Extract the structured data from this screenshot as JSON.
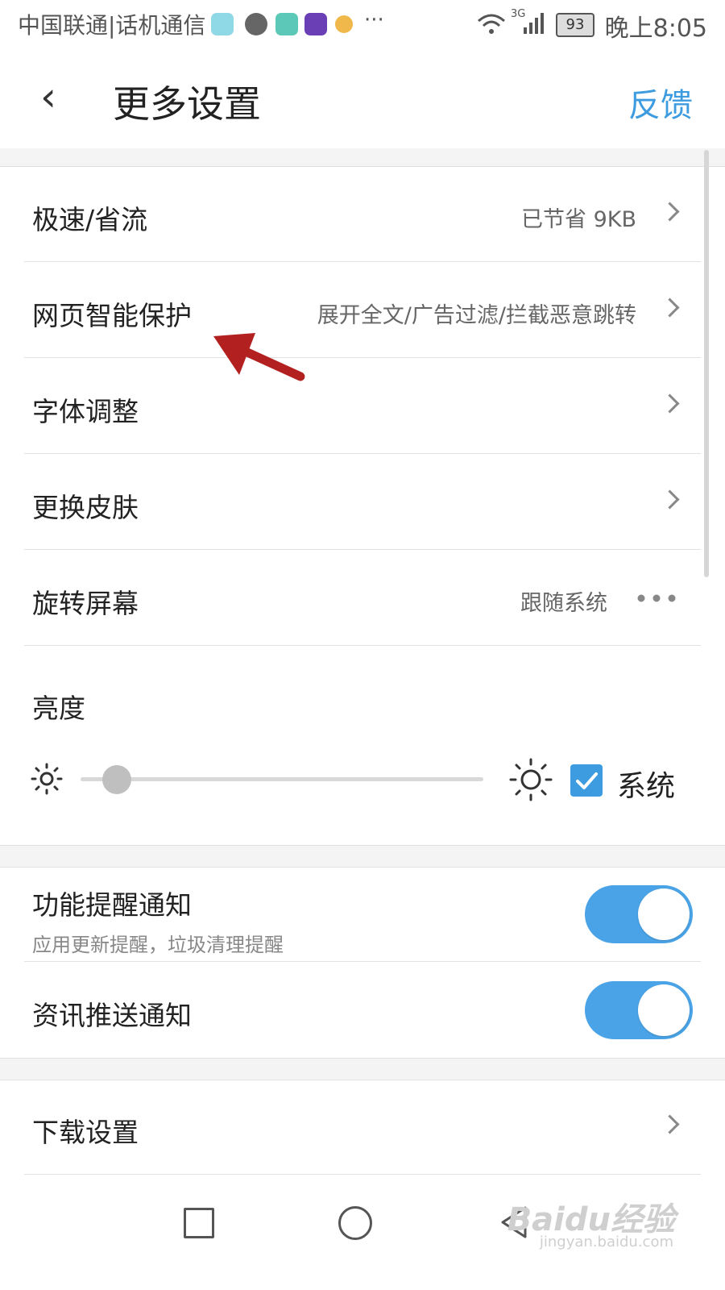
{
  "status_bar": {
    "carrier": "中国联通|话机通信",
    "battery": "93",
    "network": "3G",
    "time": "晚上8:05",
    "more": "···"
  },
  "header": {
    "back_icon": "chevron-left-icon",
    "title": "更多设置",
    "feedback": "反馈"
  },
  "rows": [
    {
      "label": "极速/省流",
      "value": "已节省 9KB",
      "trailing": "chevron-right-icon"
    },
    {
      "label": "网页智能保护",
      "value": "展开全文/广告过滤/拦截恶意跳转",
      "trailing": "chevron-right-icon"
    },
    {
      "label": "字体调整",
      "value": "",
      "trailing": "chevron-right-icon"
    },
    {
      "label": "更换皮肤",
      "value": "",
      "trailing": "chevron-right-icon"
    },
    {
      "label": "旋转屏幕",
      "value": "跟随系统",
      "trailing": "more-dots-icon"
    }
  ],
  "brightness": {
    "label": "亮度",
    "level": 0.09,
    "system_checked": true,
    "system_label": "系统"
  },
  "notifications": [
    {
      "label": "功能提醒通知",
      "sub": "应用更新提醒，垃圾清理提醒",
      "on": true
    },
    {
      "label": "资讯推送通知",
      "sub": "",
      "on": true
    }
  ],
  "download": {
    "label": "下载设置",
    "trailing": "chevron-right-icon"
  },
  "watermark": {
    "text": "Baidu经验",
    "sub": "jingyan.baidu.com"
  },
  "annotation": {
    "arrow_color": "#b32020"
  },
  "colors": {
    "accent": "#3d9be0",
    "toggle_on": "#4aa3e6"
  }
}
